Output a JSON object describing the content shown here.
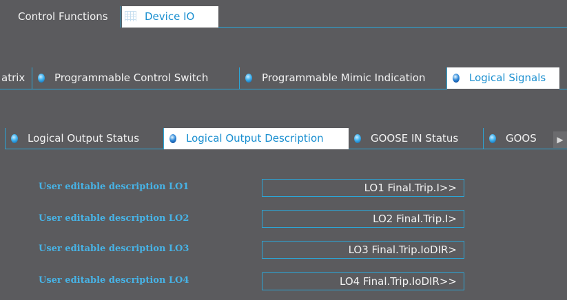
{
  "top_tabs": [
    {
      "label": "Control Functions",
      "active": false
    },
    {
      "label": "Device IO",
      "active": true,
      "icon": "grid-icon"
    }
  ],
  "mid_tabs": [
    {
      "label": "atrix",
      "active": false,
      "bullet": false
    },
    {
      "label": "Programmable Control Switch",
      "active": false,
      "bullet": true
    },
    {
      "label": "Programmable Mimic Indication",
      "active": false,
      "bullet": true
    },
    {
      "label": "Logical Signals",
      "active": true,
      "bullet": true
    }
  ],
  "sub_tabs": [
    {
      "label": "Logical Output Status",
      "active": false
    },
    {
      "label": "Logical Output Description",
      "active": true
    },
    {
      "label": "GOOSE IN Status",
      "active": false
    },
    {
      "label": "GOOS",
      "active": false
    }
  ],
  "rows": [
    {
      "label": "User editable description LO1",
      "value": "LO1 Final.Trip.I>>"
    },
    {
      "label": "User editable description LO2",
      "value": "LO2 Final.Trip.I>"
    },
    {
      "label": "User editable description LO3",
      "value": "LO3 Final.Trip.IoDIR>"
    },
    {
      "label": "User editable description LO4",
      "value": "LO4 Final.Trip.IoDIR>>"
    }
  ],
  "colors": {
    "accent": "#2aa7d9",
    "label": "#47b3e6",
    "background": "#5b5b5e"
  }
}
